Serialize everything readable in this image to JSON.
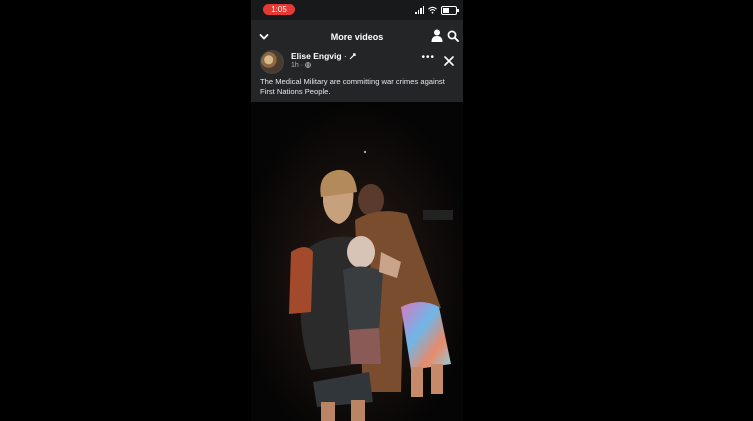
{
  "status_bar": {
    "time": "1:05"
  },
  "header": {
    "title": "More videos"
  },
  "post": {
    "author": "Elise Engvig",
    "author_separator": "·",
    "time_ago": "1h",
    "more_label": "•••",
    "caption": "The Medical Military are committing war crimes against First Nations People."
  },
  "colors": {
    "header_bg": "#242526",
    "time_pill": "#e53935"
  },
  "icons": {
    "back": "chevron-down-icon",
    "profile": "person-icon",
    "search": "search-icon",
    "more": "more-icon",
    "close": "close-icon",
    "audience": "globe-icon"
  }
}
